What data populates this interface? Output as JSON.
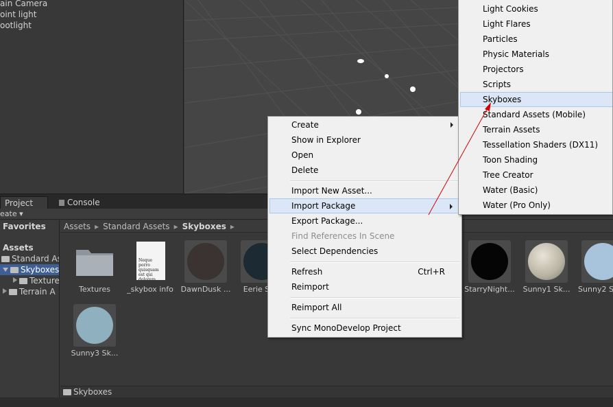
{
  "hierarchy": {
    "items": [
      "ain Camera",
      "oint light",
      "ootlight"
    ]
  },
  "tabs": {
    "project": "Project",
    "console": "Console"
  },
  "toolbar": {
    "create": "eate ▾"
  },
  "tree": {
    "favorites": "Favorites",
    "assets": "Assets",
    "standard_assets": "Standard As",
    "skyboxes": "Skyboxes",
    "textures": "Texture",
    "terrain": "Terrain A"
  },
  "breadcrumb": {
    "items": [
      "Assets",
      "Standard Assets",
      "Skyboxes"
    ],
    "sep": "▸"
  },
  "assets": [
    {
      "label": "Textures",
      "kind": "folder"
    },
    {
      "label": "_skybox info",
      "kind": "doc",
      "doc_text": "Neque porro quisquam est qui dolorem."
    },
    {
      "label": "DawnDusk ...",
      "kind": "sky",
      "color": "#3a3331"
    },
    {
      "label": "Eerie S",
      "kind": "sky",
      "color": "#1c2a33"
    },
    {
      "label": "StarryNight...",
      "kind": "sky",
      "color": "#050505"
    },
    {
      "label": "Sunny1 Sk...",
      "kind": "sky",
      "color": "#c7c1b0"
    },
    {
      "label": "Sunny2 S",
      "kind": "sky",
      "color": "#a8c4dd"
    },
    {
      "label": "Sunny3 Sk...",
      "kind": "sky",
      "color": "#8fb0bf"
    }
  ],
  "status": {
    "path": "Skyboxes"
  },
  "context_menu": {
    "create": "Create",
    "show_in_explorer": "Show in Explorer",
    "open": "Open",
    "delete": "Delete",
    "import_new_asset": "Import New Asset...",
    "import_package": "Import Package",
    "export_package": "Export Package...",
    "find_references": "Find References In Scene",
    "select_dependencies": "Select Dependencies",
    "refresh": "Refresh",
    "refresh_shortcut": "Ctrl+R",
    "reimport": "Reimport",
    "reimport_all": "Reimport All",
    "sync_monodevelop": "Sync MonoDevelop Project"
  },
  "submenu": {
    "items": [
      "Light Cookies",
      "Light Flares",
      "Particles",
      "Physic Materials",
      "Projectors",
      "Scripts",
      "Skyboxes",
      "Standard Assets (Mobile)",
      "Terrain Assets",
      "Tessellation Shaders (DX11)",
      "Toon Shading",
      "Tree Creator",
      "Water (Basic)",
      "Water (Pro Only)"
    ],
    "selected": "Skyboxes"
  },
  "colors": {
    "menu_bg": "#f0f0f0",
    "menu_hover": "#dbe7f6",
    "selection": "#3e5f96",
    "annotation": "#d40000"
  }
}
